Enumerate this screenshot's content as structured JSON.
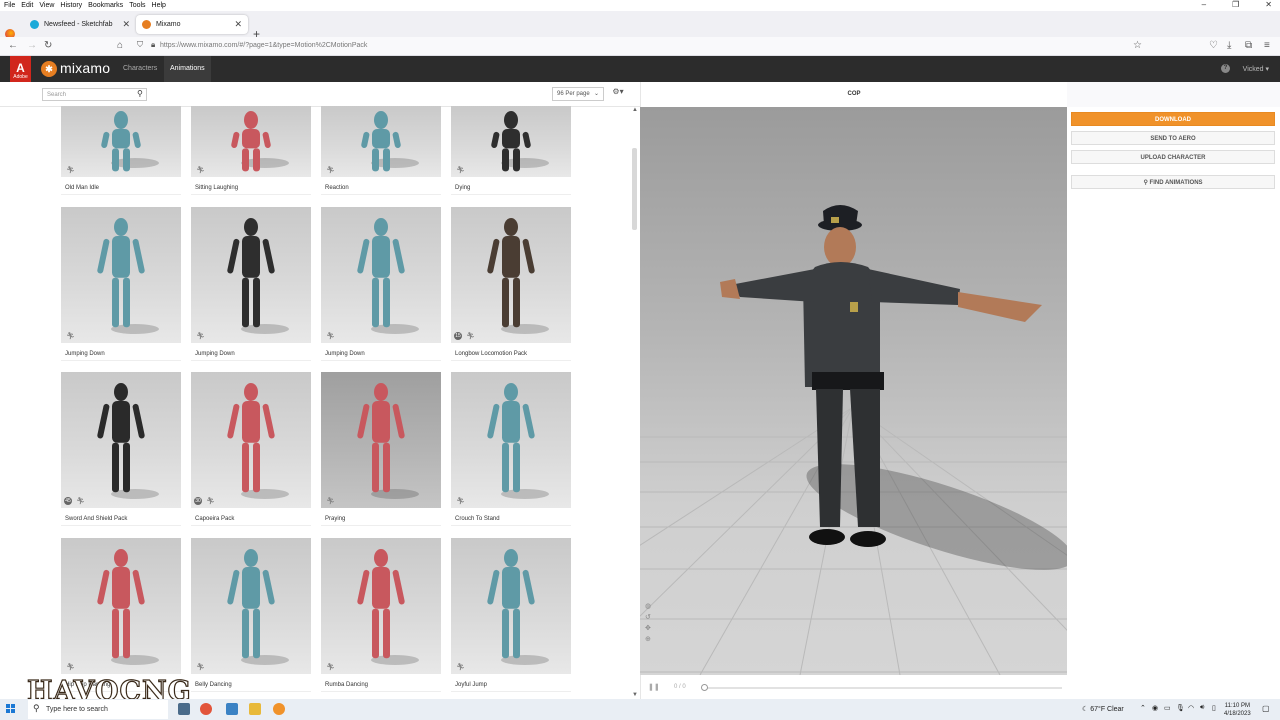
{
  "os_menu": [
    "File",
    "Edit",
    "View",
    "History",
    "Bookmarks",
    "Tools",
    "Help"
  ],
  "browser": {
    "tabs": [
      {
        "title": "Newsfeed - Sketchfab",
        "favicon_color": "#1caad9",
        "active": false
      },
      {
        "title": "Mixamo",
        "favicon_color": "#e67e22",
        "active": true
      }
    ],
    "url": "https://www.mixamo.com/#/?page=1&type=Motion%2CMotionPack"
  },
  "mixamo": {
    "adobe_text": "Adobe",
    "logo_text": "mixamo",
    "nav": [
      {
        "label": "Characters",
        "active": false
      },
      {
        "label": "Animations",
        "active": true
      }
    ],
    "user": "Vicked ▾",
    "accent_color": "#f0922a"
  },
  "left": {
    "search_placeholder": "Search",
    "per_page": "96 Per page",
    "cards": [
      {
        "label": "Old Man Idle",
        "color": "#5f9aa6",
        "pack": false
      },
      {
        "label": "Sitting Laughing",
        "color": "#c8585e",
        "pack": false
      },
      {
        "label": "Reaction",
        "color": "#5f9aa6",
        "pack": false
      },
      {
        "label": "Dying",
        "color": "#2e2e2e",
        "pack": false
      },
      {
        "label": "Jumping Down",
        "color": "#5f9aa6",
        "pack": false
      },
      {
        "label": "Jumping Down",
        "color": "#2e2e2e",
        "pack": false
      },
      {
        "label": "Jumping Down",
        "color": "#5f9aa6",
        "pack": false
      },
      {
        "label": "Longbow Locomotion Pack",
        "color": "#4a3d33",
        "pack": true,
        "pack_count": "15"
      },
      {
        "label": "Sword And Shield Pack",
        "color": "#2a2a2a",
        "pack": true,
        "pack_count": "45"
      },
      {
        "label": "Capoeira Pack",
        "color": "#c8585e",
        "pack": true,
        "pack_count": "30"
      },
      {
        "label": "Praying",
        "color": "#c8585e",
        "pack": false
      },
      {
        "label": "Crouch To Stand",
        "color": "#5f9aa6",
        "pack": false
      },
      {
        "label": "Hip Hop Dancing",
        "color": "#c8585e",
        "pack": false
      },
      {
        "label": "Belly Dancing",
        "color": "#5f9aa6",
        "pack": false
      },
      {
        "label": "Rumba Dancing",
        "color": "#c8585e",
        "pack": false
      },
      {
        "label": "Joyful Jump",
        "color": "#5f9aa6",
        "pack": false
      }
    ]
  },
  "viewer": {
    "title": "COP",
    "frames": "0 / 0"
  },
  "actions": {
    "download": "DOWNLOAD",
    "send_to_aero": "SEND TO AERO",
    "upload_character": "UPLOAD CHARACTER",
    "find_animations": "FIND ANIMATIONS"
  },
  "taskbar": {
    "search_placeholder": "Type here to search",
    "weather": "67°F  Clear",
    "time": "11:10 PM",
    "date": "4/18/2023"
  },
  "watermark": "HAVOCNG"
}
